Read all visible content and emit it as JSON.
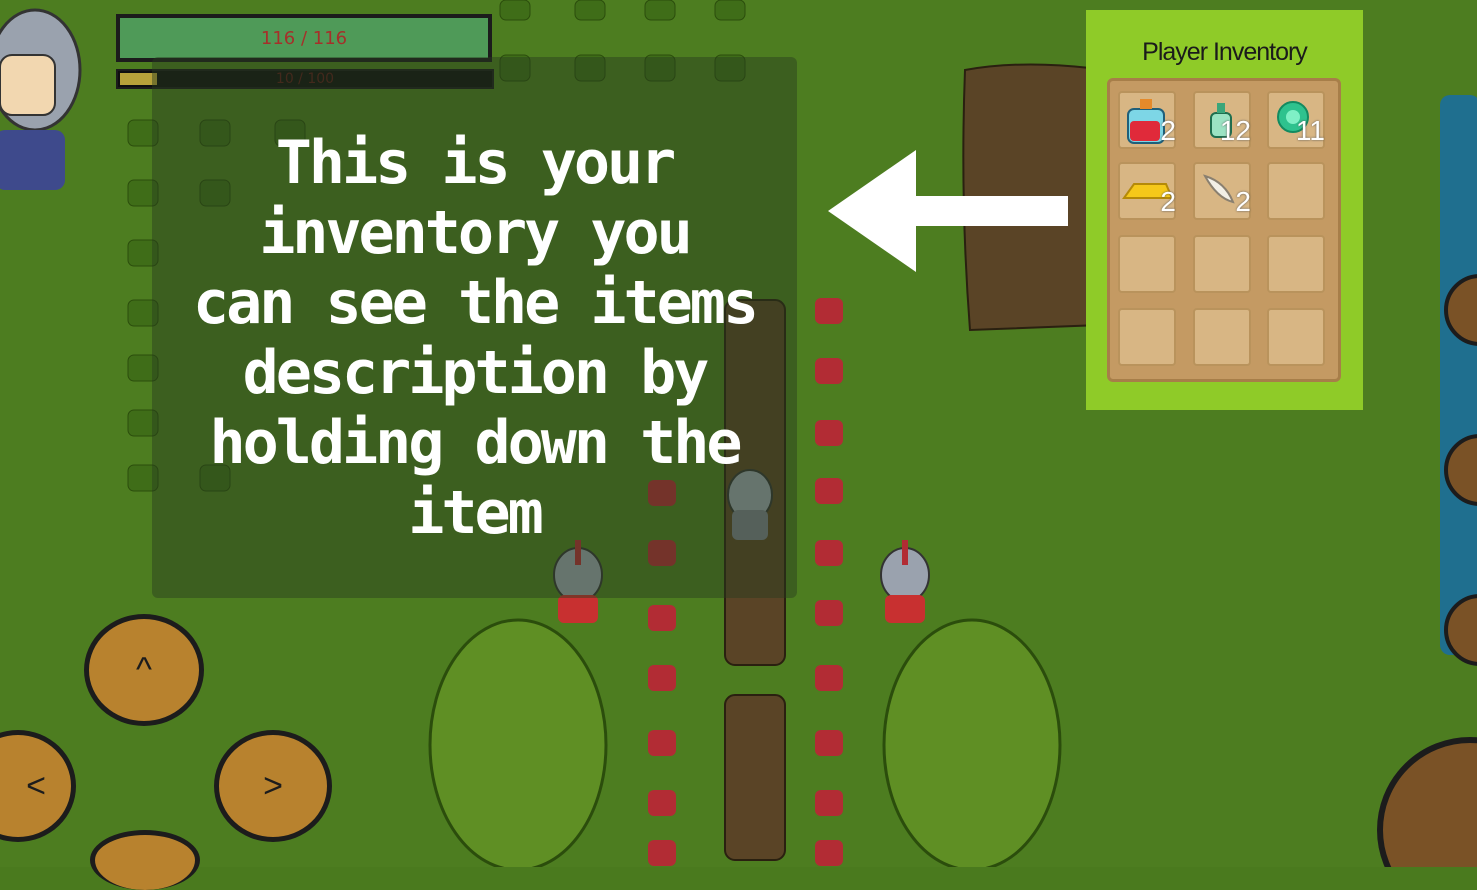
{
  "hud": {
    "health_text": "116 / 116",
    "health_fraction": 1.0,
    "xp_text": "10 / 100",
    "xp_fraction": 0.1
  },
  "tutorial": {
    "lines": [
      "This is your",
      "inventory you",
      "can see the items",
      "description by",
      "holding down the",
      "item"
    ]
  },
  "inventory": {
    "title": "Player Inventory",
    "slots": [
      {
        "item": "red-potion-icon",
        "count": "2"
      },
      {
        "item": "green-potion-icon",
        "count": "12"
      },
      {
        "item": "emerald-gem-icon",
        "count": "11"
      },
      {
        "item": "gold-bar-icon",
        "count": "2"
      },
      {
        "item": "feather-icon",
        "count": "2"
      },
      {
        "item": "",
        "count": ""
      },
      {
        "item": "",
        "count": ""
      },
      {
        "item": "",
        "count": ""
      },
      {
        "item": "",
        "count": ""
      },
      {
        "item": "",
        "count": ""
      },
      {
        "item": "",
        "count": ""
      },
      {
        "item": "",
        "count": ""
      }
    ]
  },
  "controls": {
    "up_label": "^",
    "left_label": "<",
    "right_label": ">"
  },
  "colors": {
    "grass": "#4a7a1e",
    "panel_green": "#8fcb28",
    "button_brown": "#b8822e"
  }
}
